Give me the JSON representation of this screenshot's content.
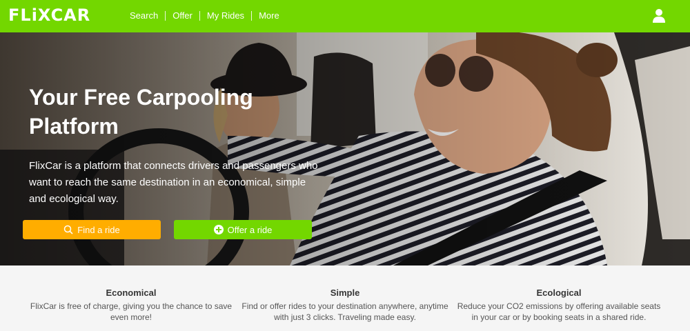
{
  "header": {
    "logo": "FLiXCAR",
    "nav": [
      {
        "label": "Search"
      },
      {
        "label": "Offer"
      },
      {
        "label": "My Rides"
      },
      {
        "label": "More"
      }
    ],
    "user_icon": "user-icon"
  },
  "hero": {
    "title": "Your Free Carpooling Platform",
    "description": "FlixCar is a platform that connects drivers and passengers who want to reach the same destination in an economical, simple and ecological way.",
    "find_button": {
      "label": "Find a ride",
      "icon": "search-icon"
    },
    "offer_button": {
      "label": "Offer a ride",
      "icon": "plus-circle-icon"
    }
  },
  "features": [
    {
      "title": "Economical",
      "text": "FlixCar is free of charge, giving you the chance to save even more!"
    },
    {
      "title": "Simple",
      "text": "Find or offer rides to your destination anywhere, anytime with just 3 clicks. Traveling made easy."
    },
    {
      "title": "Ecological",
      "text": "Reduce your CO2 emissions by offering available seats in your car or by booking seats in a shared ride."
    }
  ],
  "colors": {
    "brand_green": "#73d700",
    "find_orange": "#ffad00",
    "feature_bg": "#f5f5f5"
  }
}
